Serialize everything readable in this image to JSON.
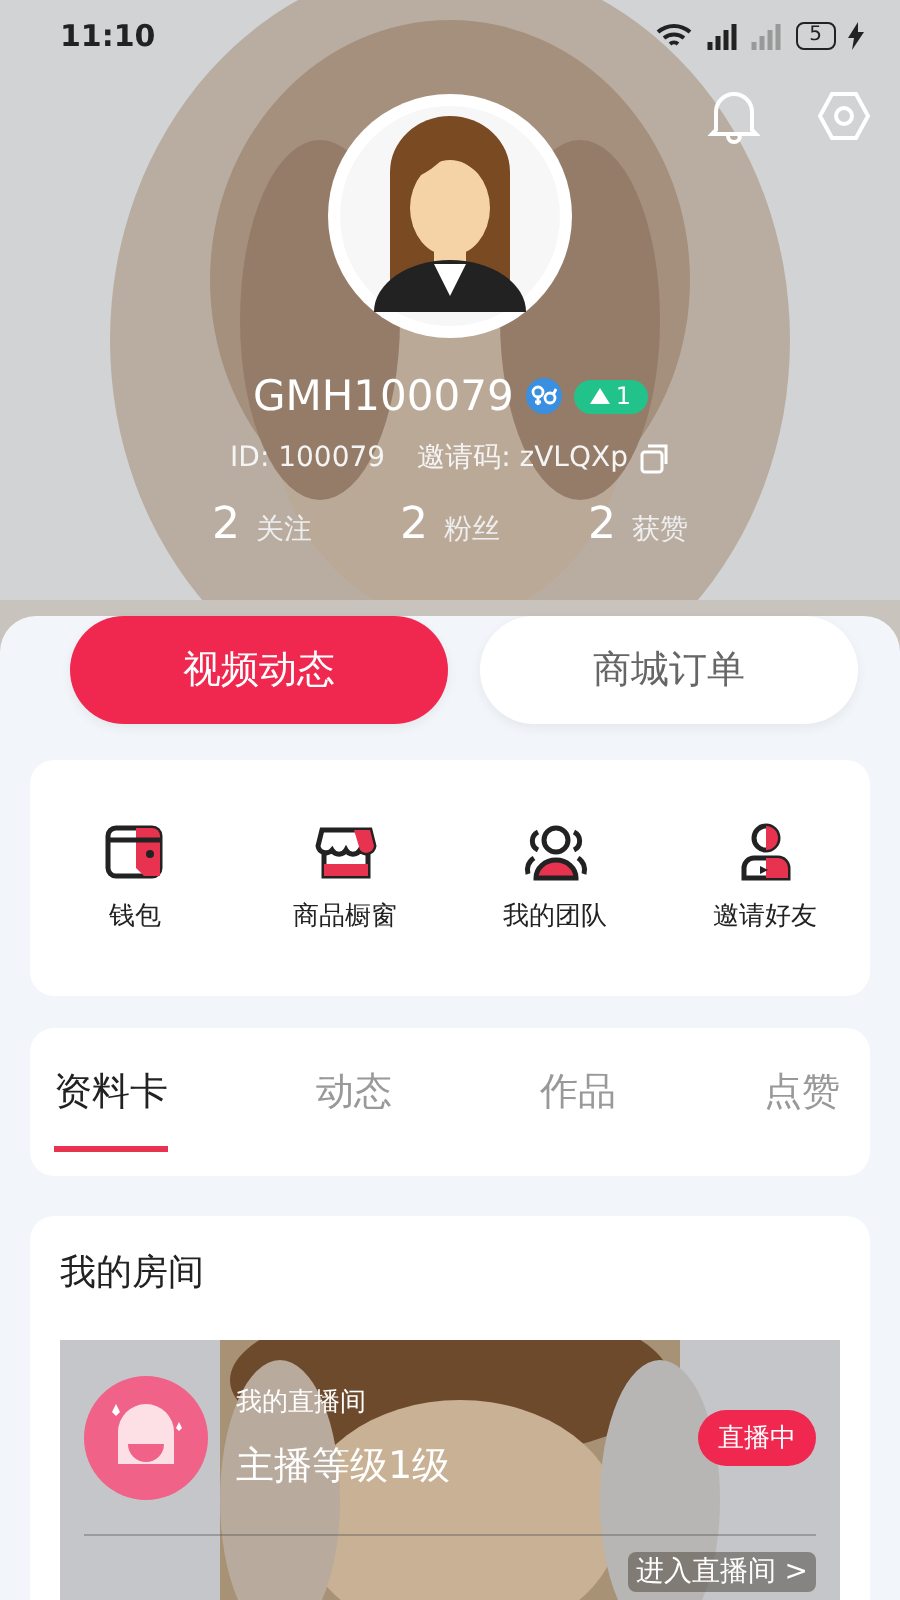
{
  "status_bar": {
    "time": "11:10",
    "battery": "5"
  },
  "profile": {
    "name": "GMH100079",
    "level": "1",
    "id": "ID: 100079",
    "invite_code": "邀请码: zVLQXp",
    "stats": [
      {
        "value": "2",
        "label": "关注"
      },
      {
        "value": "2",
        "label": "粉丝"
      },
      {
        "value": "2",
        "label": "获赞"
      }
    ]
  },
  "segments": [
    {
      "label": "视频动态",
      "selected": true
    },
    {
      "label": "商城订单",
      "selected": false
    }
  ],
  "shortcuts": [
    {
      "kind": "wallet",
      "label": "钱包"
    },
    {
      "kind": "shop",
      "label": "商品橱窗"
    },
    {
      "kind": "team",
      "label": "我的团队"
    },
    {
      "kind": "invite",
      "label": "邀请好友"
    }
  ],
  "tabs": [
    {
      "label": "资料卡",
      "selected": true
    },
    {
      "label": "动态",
      "selected": false
    },
    {
      "label": "作品",
      "selected": false
    },
    {
      "label": "点赞",
      "selected": false
    }
  ],
  "room": {
    "title": "我的房间",
    "subtitle": "我的直播间",
    "level_text": "主播等级1级",
    "status": "直播中",
    "enter": "进入直播间 >"
  }
}
